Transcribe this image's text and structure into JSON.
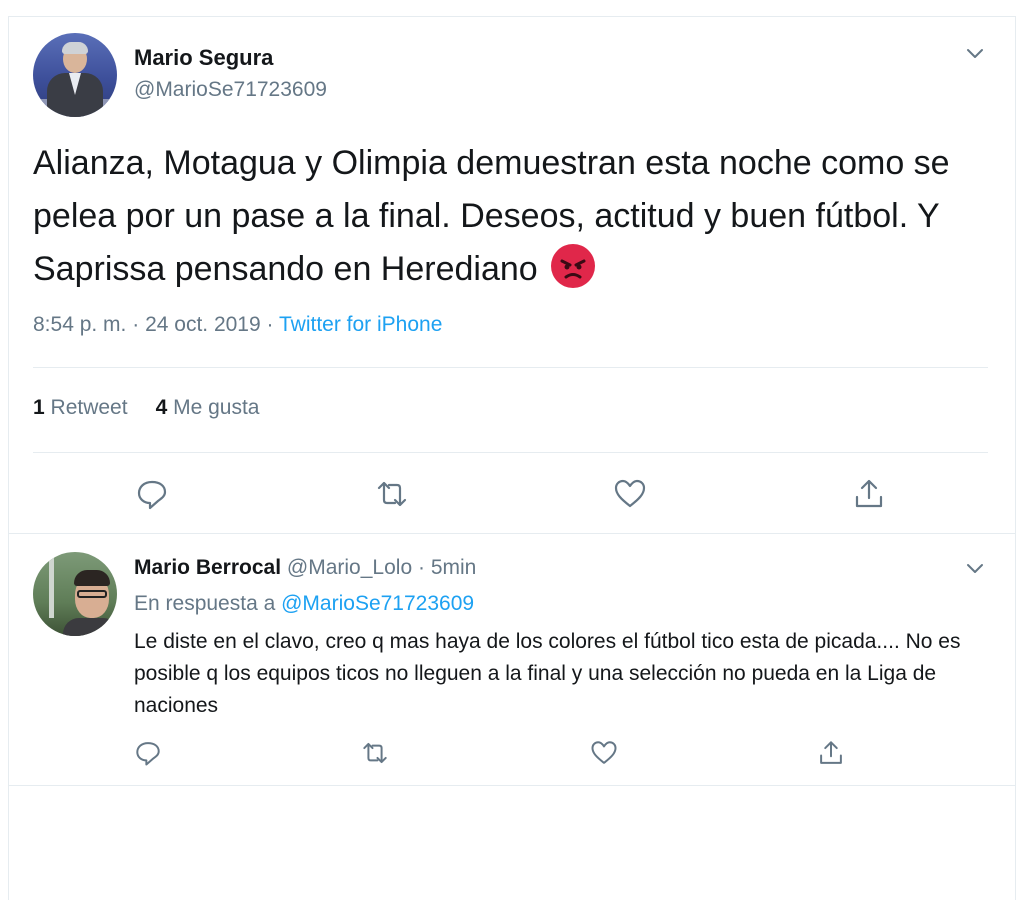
{
  "tweet": {
    "author_name": "Mario Segura",
    "author_handle": "@MarioSe71723609",
    "text": "Alianza, Motagua y Olimpia demuestran esta noche como se pelea por un pase a la final. Deseos, actitud y buen fútbol. Y Saprissa pensando en Herediano",
    "emoji": "angry-face-emoji",
    "time": "8:54 p. m.",
    "date": "24 oct. 2019",
    "separator": "·",
    "source": "Twitter for iPhone",
    "retweet_count": "1",
    "retweet_label": "Retweet",
    "like_count": "4",
    "like_label": "Me gusta",
    "actions": [
      "reply-icon",
      "retweet-icon",
      "like-icon",
      "share-icon"
    ]
  },
  "reply": {
    "author_name": "Mario Berrocal",
    "author_handle": "@Mario_Lolo",
    "separator": "·",
    "time_ago": "5min",
    "in_reply_to_label": "En respuesta a",
    "in_reply_to_handle": "@MarioSe71723609",
    "text": "Le diste en el clavo, creo q mas haya de los colores el fútbol tico esta de picada.... No es posible q los equipos ticos no lleguen a la final y una selección no pueda en la Liga de naciones",
    "actions": [
      "reply-icon",
      "retweet-icon",
      "like-icon",
      "share-icon"
    ]
  },
  "colors": {
    "text": "#14171a",
    "secondary": "#657786",
    "link": "#1da1f2",
    "border": "#e6ecf0",
    "emoji": "#e0274a"
  }
}
